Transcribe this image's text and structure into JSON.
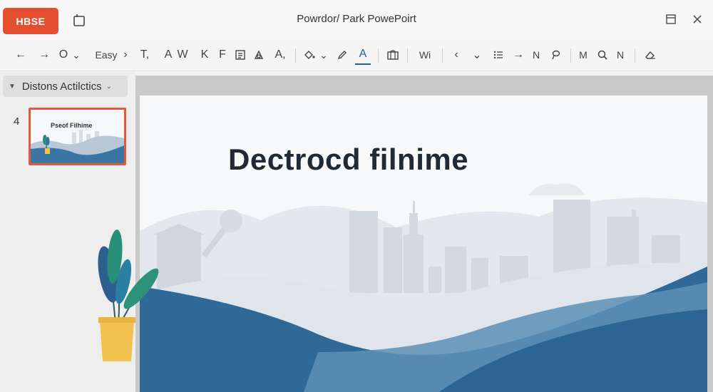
{
  "window": {
    "app_button_label": "HBSE",
    "document_title": "Powrdor/ Park PowePoirt"
  },
  "toolbar": {
    "items": [
      {
        "label": "←",
        "icon": "back-arrow-icon"
      },
      {
        "label": "→",
        "icon": "forward-arrow-icon"
      },
      {
        "label": "O",
        "icon": "circle-icon"
      },
      {
        "label": "Easy",
        "icon": "style-dropdown"
      },
      {
        "label": "›",
        "icon": "chevron-right-icon"
      },
      {
        "label": "T,",
        "icon": "text-icon"
      },
      {
        "label": "A",
        "icon": "font-a-icon"
      },
      {
        "label": "W",
        "icon": "font-w-icon"
      },
      {
        "label": "K",
        "icon": "font-k-icon"
      },
      {
        "label": "F",
        "icon": "font-f-icon"
      },
      {
        "label": "A,",
        "icon": "font-size-icon"
      },
      {
        "label": "A",
        "icon": "font-color-icon"
      },
      {
        "label": "Wi",
        "icon": "wi-label"
      },
      {
        "label": "‹",
        "icon": "chevron-left-icon"
      },
      {
        "label": "⌄",
        "icon": "chevron-down-icon"
      },
      {
        "label": "→",
        "icon": "right-arrow-icon"
      },
      {
        "label": "N",
        "icon": "n-icon"
      },
      {
        "label": "M",
        "icon": "m-icon"
      },
      {
        "label": "N",
        "icon": "n2-icon"
      }
    ]
  },
  "panel": {
    "dropdown_label": "Distons Actilctics",
    "slide_number": "4",
    "thumbnail_title": "Pseof Filhime"
  },
  "slide": {
    "title": "Dectrocd filnime"
  },
  "colors": {
    "accent": "#e4502f",
    "thumb_border": "#e05a3a",
    "water_dark": "#2f6a96",
    "title_text": "#1f2a36"
  }
}
